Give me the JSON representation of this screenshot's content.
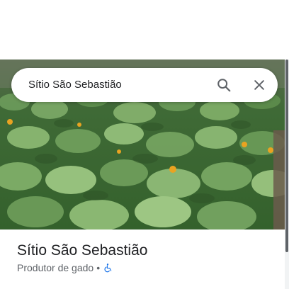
{
  "search": {
    "query": "Sítio São Sebastião"
  },
  "place": {
    "name": "Sítio São Sebastião",
    "category": "Produtor de gado",
    "separator": "•"
  },
  "icons": {
    "search": "search-icon",
    "close": "close-icon",
    "accessibility": "wheelchair-icon"
  },
  "colors": {
    "text_primary": "#202124",
    "text_secondary": "#5f6368",
    "icon": "#5f6368",
    "accessibility": "#1a73e8"
  }
}
